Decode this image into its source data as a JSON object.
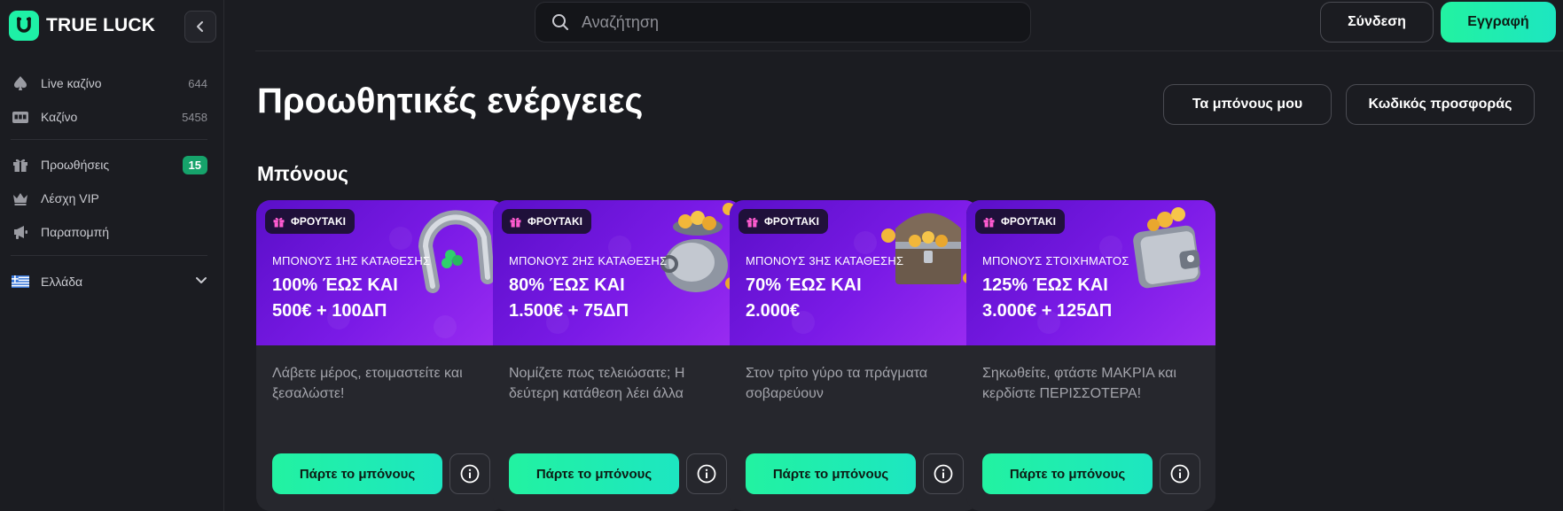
{
  "brand": {
    "name": "TRUE LUCK"
  },
  "sidebar": {
    "items": [
      {
        "label": "Live καζίνο",
        "count": "644",
        "icon": "spade-icon"
      },
      {
        "label": "Καζίνο",
        "count": "5458",
        "icon": "slot-machine-icon"
      },
      {
        "label": "Προωθήσεις",
        "badge": "15",
        "icon": "gift-icon"
      },
      {
        "label": "Λέσχη VIP",
        "icon": "crown-icon"
      },
      {
        "label": "Παραπομπή",
        "icon": "megaphone-icon"
      },
      {
        "label": "Ελλάδα",
        "icon": "greece-flag-icon"
      }
    ]
  },
  "header": {
    "search_placeholder": "Αναζήτηση",
    "login_label": "Σύνδεση",
    "register_label": "Εγγραφή"
  },
  "page": {
    "title": "Προωθητικές ενέργειες",
    "my_bonus_label": "Τα μπόνους μου",
    "promo_code_label": "Κωδικός προσφοράς",
    "section_title": "Μπόνους"
  },
  "cards": [
    {
      "tag": "ΦΡΟΥΤΑΚΙ",
      "subtitle": "ΜΠΟΝΟΥΣ 1ΗΣ ΚΑΤΑΘΕΣΗΣ",
      "line1": "100% ΈΩΣ ΚΑΙ",
      "line2": "500€ + 100ΔΠ",
      "description": "Λάβετε μέρος, ετοιμαστείτε και ξεσαλώστε!",
      "cta": "Πάρτε το μπόνους",
      "art": "horseshoe-icon"
    },
    {
      "tag": "ΦΡΟΥΤΑΚΙ",
      "subtitle": "ΜΠΟΝΟΥΣ 2ΗΣ ΚΑΤΑΘΕΣΗΣ",
      "line1": "80% ΈΩΣ ΚΑΙ",
      "line2": "1.500€ + 75ΔΠ",
      "description": "Νομίζετε πως τελειώσατε; Η δεύτερη κατάθεση λέει άλλα",
      "cta": "Πάρτε το μπόνους",
      "art": "coin-pot-icon"
    },
    {
      "tag": "ΦΡΟΥΤΑΚΙ",
      "subtitle": "ΜΠΟΝΟΥΣ 3ΗΣ ΚΑΤΑΘΕΣΗΣ",
      "line1": "70% ΈΩΣ ΚΑΙ",
      "line2": "2.000€",
      "description": "Στον τρίτο γύρο τα πράγματα σοβαρεύουν",
      "cta": "Πάρτε το μπόνους",
      "art": "treasure-chest-icon"
    },
    {
      "tag": "ΦΡΟΥΤΑΚΙ",
      "subtitle": "ΜΠΟΝΟΥΣ ΣΤΟΙΧΗΜΑΤΟΣ",
      "line1": "125% ΈΩΣ ΚΑΙ",
      "line2": "3.000€ + 125ΔΠ",
      "description": "Σηκωθείτε, φτάστε ΜΑΚΡΙΑ και κερδίστε ΠΕΡΙΣΣΟΤΕΡΑ!",
      "cta": "Πάρτε το μπόνους",
      "art": "wallet-icon"
    }
  ],
  "colors": {
    "accent": "#22f2a1",
    "background": "#1b1c21",
    "card": "#26272d",
    "banner": "#7a1ae6",
    "badge": "#16a36b"
  }
}
